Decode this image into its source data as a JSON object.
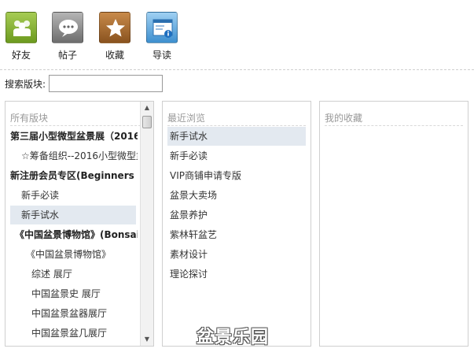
{
  "toolbar": {
    "friends_label": "好友",
    "posts_label": "帖子",
    "favorites_label": "收藏",
    "guide_label": "导读"
  },
  "search": {
    "label": "搜索版块:",
    "value": "",
    "placeholder": ""
  },
  "all_forums": {
    "title": "所有版块",
    "items": [
      {
        "label": "第三届小型微型盆景展（2016"
      },
      {
        "label": "☆筹备组织--2016小型微型盆"
      },
      {
        "label": "新注册会员专区(Beginners a"
      },
      {
        "label": "新手必读"
      },
      {
        "label": "新手试水"
      },
      {
        "label": "《中国盆景博物馆》(Bonsai"
      },
      {
        "label": "《中国盆景博物馆》"
      },
      {
        "label": "综述 展厅"
      },
      {
        "label": "中国盆景史 展厅"
      },
      {
        "label": "中国盆景盆器展厅"
      },
      {
        "label": "中国盆景盆几展厅"
      }
    ]
  },
  "recent": {
    "title": "最近浏览",
    "items": [
      {
        "label": "新手试水"
      },
      {
        "label": "新手必读"
      },
      {
        "label": "VIP商铺申请专版"
      },
      {
        "label": "盆景大卖场"
      },
      {
        "label": "盆景养护"
      },
      {
        "label": "紫林轩盆艺"
      },
      {
        "label": "素材设计"
      },
      {
        "label": "理论探讨"
      }
    ]
  },
  "favorites": {
    "title": "我的收藏"
  },
  "watermark": "盆景乐园"
}
